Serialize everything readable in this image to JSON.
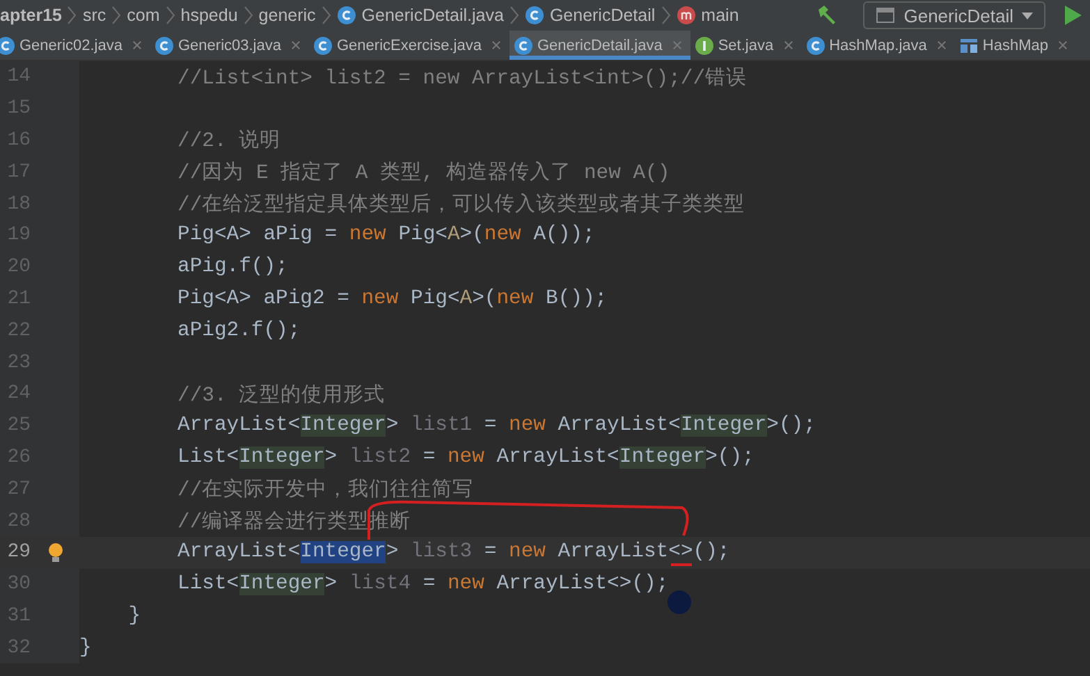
{
  "breadcrumb": [
    {
      "label": "apter15",
      "kind": "folder"
    },
    {
      "label": "src",
      "kind": "folder"
    },
    {
      "label": "com",
      "kind": "folder"
    },
    {
      "label": "hspedu",
      "kind": "folder"
    },
    {
      "label": "generic",
      "kind": "folder"
    },
    {
      "label": "GenericDetail.java",
      "kind": "class"
    },
    {
      "label": "GenericDetail",
      "kind": "class"
    },
    {
      "label": "main",
      "kind": "method"
    }
  ],
  "run_config": {
    "label": "GenericDetail"
  },
  "tabs": [
    {
      "label": "Generic02.java",
      "kind": "class",
      "selected": false
    },
    {
      "label": "Generic03.java",
      "kind": "class",
      "selected": false
    },
    {
      "label": "GenericExercise.java",
      "kind": "class",
      "selected": false
    },
    {
      "label": "GenericDetail.java",
      "kind": "class",
      "selected": true
    },
    {
      "label": "Set.java",
      "kind": "interface",
      "selected": false
    },
    {
      "label": "HashMap.java",
      "kind": "class",
      "selected": false
    },
    {
      "label": "HashMap",
      "kind": "structure",
      "selected": false
    }
  ],
  "editor": {
    "lines": [
      {
        "number": "14",
        "current": false,
        "bulb": false,
        "tokens": [
          {
            "text": "        //List<int> list2 = new ArrayList<int>();//错误",
            "kind": "comment"
          }
        ]
      },
      {
        "number": "15",
        "current": false,
        "bulb": false
      },
      {
        "number": "16",
        "current": false,
        "bulb": false,
        "tokens": [
          {
            "text": "        //2. 说明",
            "kind": "comment"
          }
        ]
      },
      {
        "number": "17",
        "current": false,
        "bulb": false,
        "tokens": [
          {
            "text": "        //因为 E 指定了 A 类型, 构造器传入了 new A()",
            "kind": "comment"
          }
        ]
      },
      {
        "number": "18",
        "current": false,
        "bulb": false,
        "tokens": [
          {
            "text": "        //在给泛型指定具体类型后，可以传入该类型或者其子类类型",
            "kind": "comment"
          }
        ]
      },
      {
        "number": "19",
        "current": false,
        "bulb": false,
        "tokens": [
          {
            "text": "        Pig<A> aPig = ",
            "kind": "plain"
          },
          {
            "text": "new",
            "kind": "keyword"
          },
          {
            "text": " Pig<",
            "kind": "plain"
          },
          {
            "text": "A",
            "kind": "type-arg"
          },
          {
            "text": ">(",
            "kind": "plain"
          },
          {
            "text": "new",
            "kind": "keyword"
          },
          {
            "text": " A());",
            "kind": "plain"
          }
        ]
      },
      {
        "number": "20",
        "current": false,
        "bulb": false,
        "tokens": [
          {
            "text": "        aPig.f();",
            "kind": "plain"
          }
        ]
      },
      {
        "number": "21",
        "current": false,
        "bulb": false,
        "tokens": [
          {
            "text": "        Pig<A> aPig2 = ",
            "kind": "plain"
          },
          {
            "text": "new",
            "kind": "keyword"
          },
          {
            "text": " Pig<",
            "kind": "plain"
          },
          {
            "text": "A",
            "kind": "type-arg"
          },
          {
            "text": ">(",
            "kind": "plain"
          },
          {
            "text": "new",
            "kind": "keyword"
          },
          {
            "text": " B());",
            "kind": "plain"
          }
        ]
      },
      {
        "number": "22",
        "current": false,
        "bulb": false,
        "tokens": [
          {
            "text": "        aPig2.f();",
            "kind": "plain"
          }
        ]
      },
      {
        "number": "23",
        "current": false,
        "bulb": false
      },
      {
        "number": "24",
        "current": false,
        "bulb": false,
        "tokens": [
          {
            "text": "        //3. 泛型的使用形式",
            "kind": "comment"
          }
        ]
      },
      {
        "number": "25",
        "current": false,
        "bulb": false,
        "tokens": [
          {
            "text": "        ArrayList<",
            "kind": "plain"
          },
          {
            "text": "Integer",
            "kind": "hint"
          },
          {
            "text": "> ",
            "kind": "plain"
          },
          {
            "text": "list1",
            "kind": "unused"
          },
          {
            "text": " = ",
            "kind": "plain"
          },
          {
            "text": "new",
            "kind": "keyword"
          },
          {
            "text": " ArrayList<",
            "kind": "plain"
          },
          {
            "text": "Integer",
            "kind": "hint"
          },
          {
            "text": ">();",
            "kind": "plain"
          }
        ]
      },
      {
        "number": "26",
        "current": false,
        "bulb": false,
        "tokens": [
          {
            "text": "        List<",
            "kind": "plain"
          },
          {
            "text": "Integer",
            "kind": "hint"
          },
          {
            "text": "> ",
            "kind": "plain"
          },
          {
            "text": "list2",
            "kind": "unused"
          },
          {
            "text": " = ",
            "kind": "plain"
          },
          {
            "text": "new",
            "kind": "keyword"
          },
          {
            "text": " ArrayList<",
            "kind": "plain"
          },
          {
            "text": "Integer",
            "kind": "hint"
          },
          {
            "text": ">();",
            "kind": "plain"
          }
        ]
      },
      {
        "number": "27",
        "current": false,
        "bulb": false,
        "tokens": [
          {
            "text": "        //在实际开发中，我们往往简写",
            "kind": "comment"
          }
        ]
      },
      {
        "number": "28",
        "current": false,
        "bulb": false,
        "tokens": [
          {
            "text": "        //编译器会进行类型推断",
            "kind": "comment"
          }
        ]
      },
      {
        "number": "29",
        "current": true,
        "bulb": true,
        "tokens": [
          {
            "text": "        ArrayList<",
            "kind": "plain"
          },
          {
            "text": "Integer",
            "kind": "selection"
          },
          {
            "text": "> ",
            "kind": "plain"
          },
          {
            "text": "list3",
            "kind": "unused"
          },
          {
            "text": " = ",
            "kind": "plain"
          },
          {
            "text": "new",
            "kind": "keyword"
          },
          {
            "text": " ArrayList<>();",
            "kind": "plain"
          }
        ]
      },
      {
        "number": "30",
        "current": false,
        "bulb": false,
        "tokens": [
          {
            "text": "        List<",
            "kind": "plain"
          },
          {
            "text": "Integer",
            "kind": "hint"
          },
          {
            "text": "> ",
            "kind": "plain"
          },
          {
            "text": "list4",
            "kind": "unused"
          },
          {
            "text": " = ",
            "kind": "plain"
          },
          {
            "text": "new",
            "kind": "keyword"
          },
          {
            "text": " ArrayList<>();",
            "kind": "plain"
          }
        ]
      },
      {
        "number": "31",
        "current": false,
        "bulb": false,
        "tokens": [
          {
            "text": "    }",
            "kind": "plain"
          }
        ]
      },
      {
        "number": "32",
        "current": false,
        "bulb": false,
        "tokens": [
          {
            "text": "}",
            "kind": "plain"
          }
        ]
      }
    ]
  }
}
